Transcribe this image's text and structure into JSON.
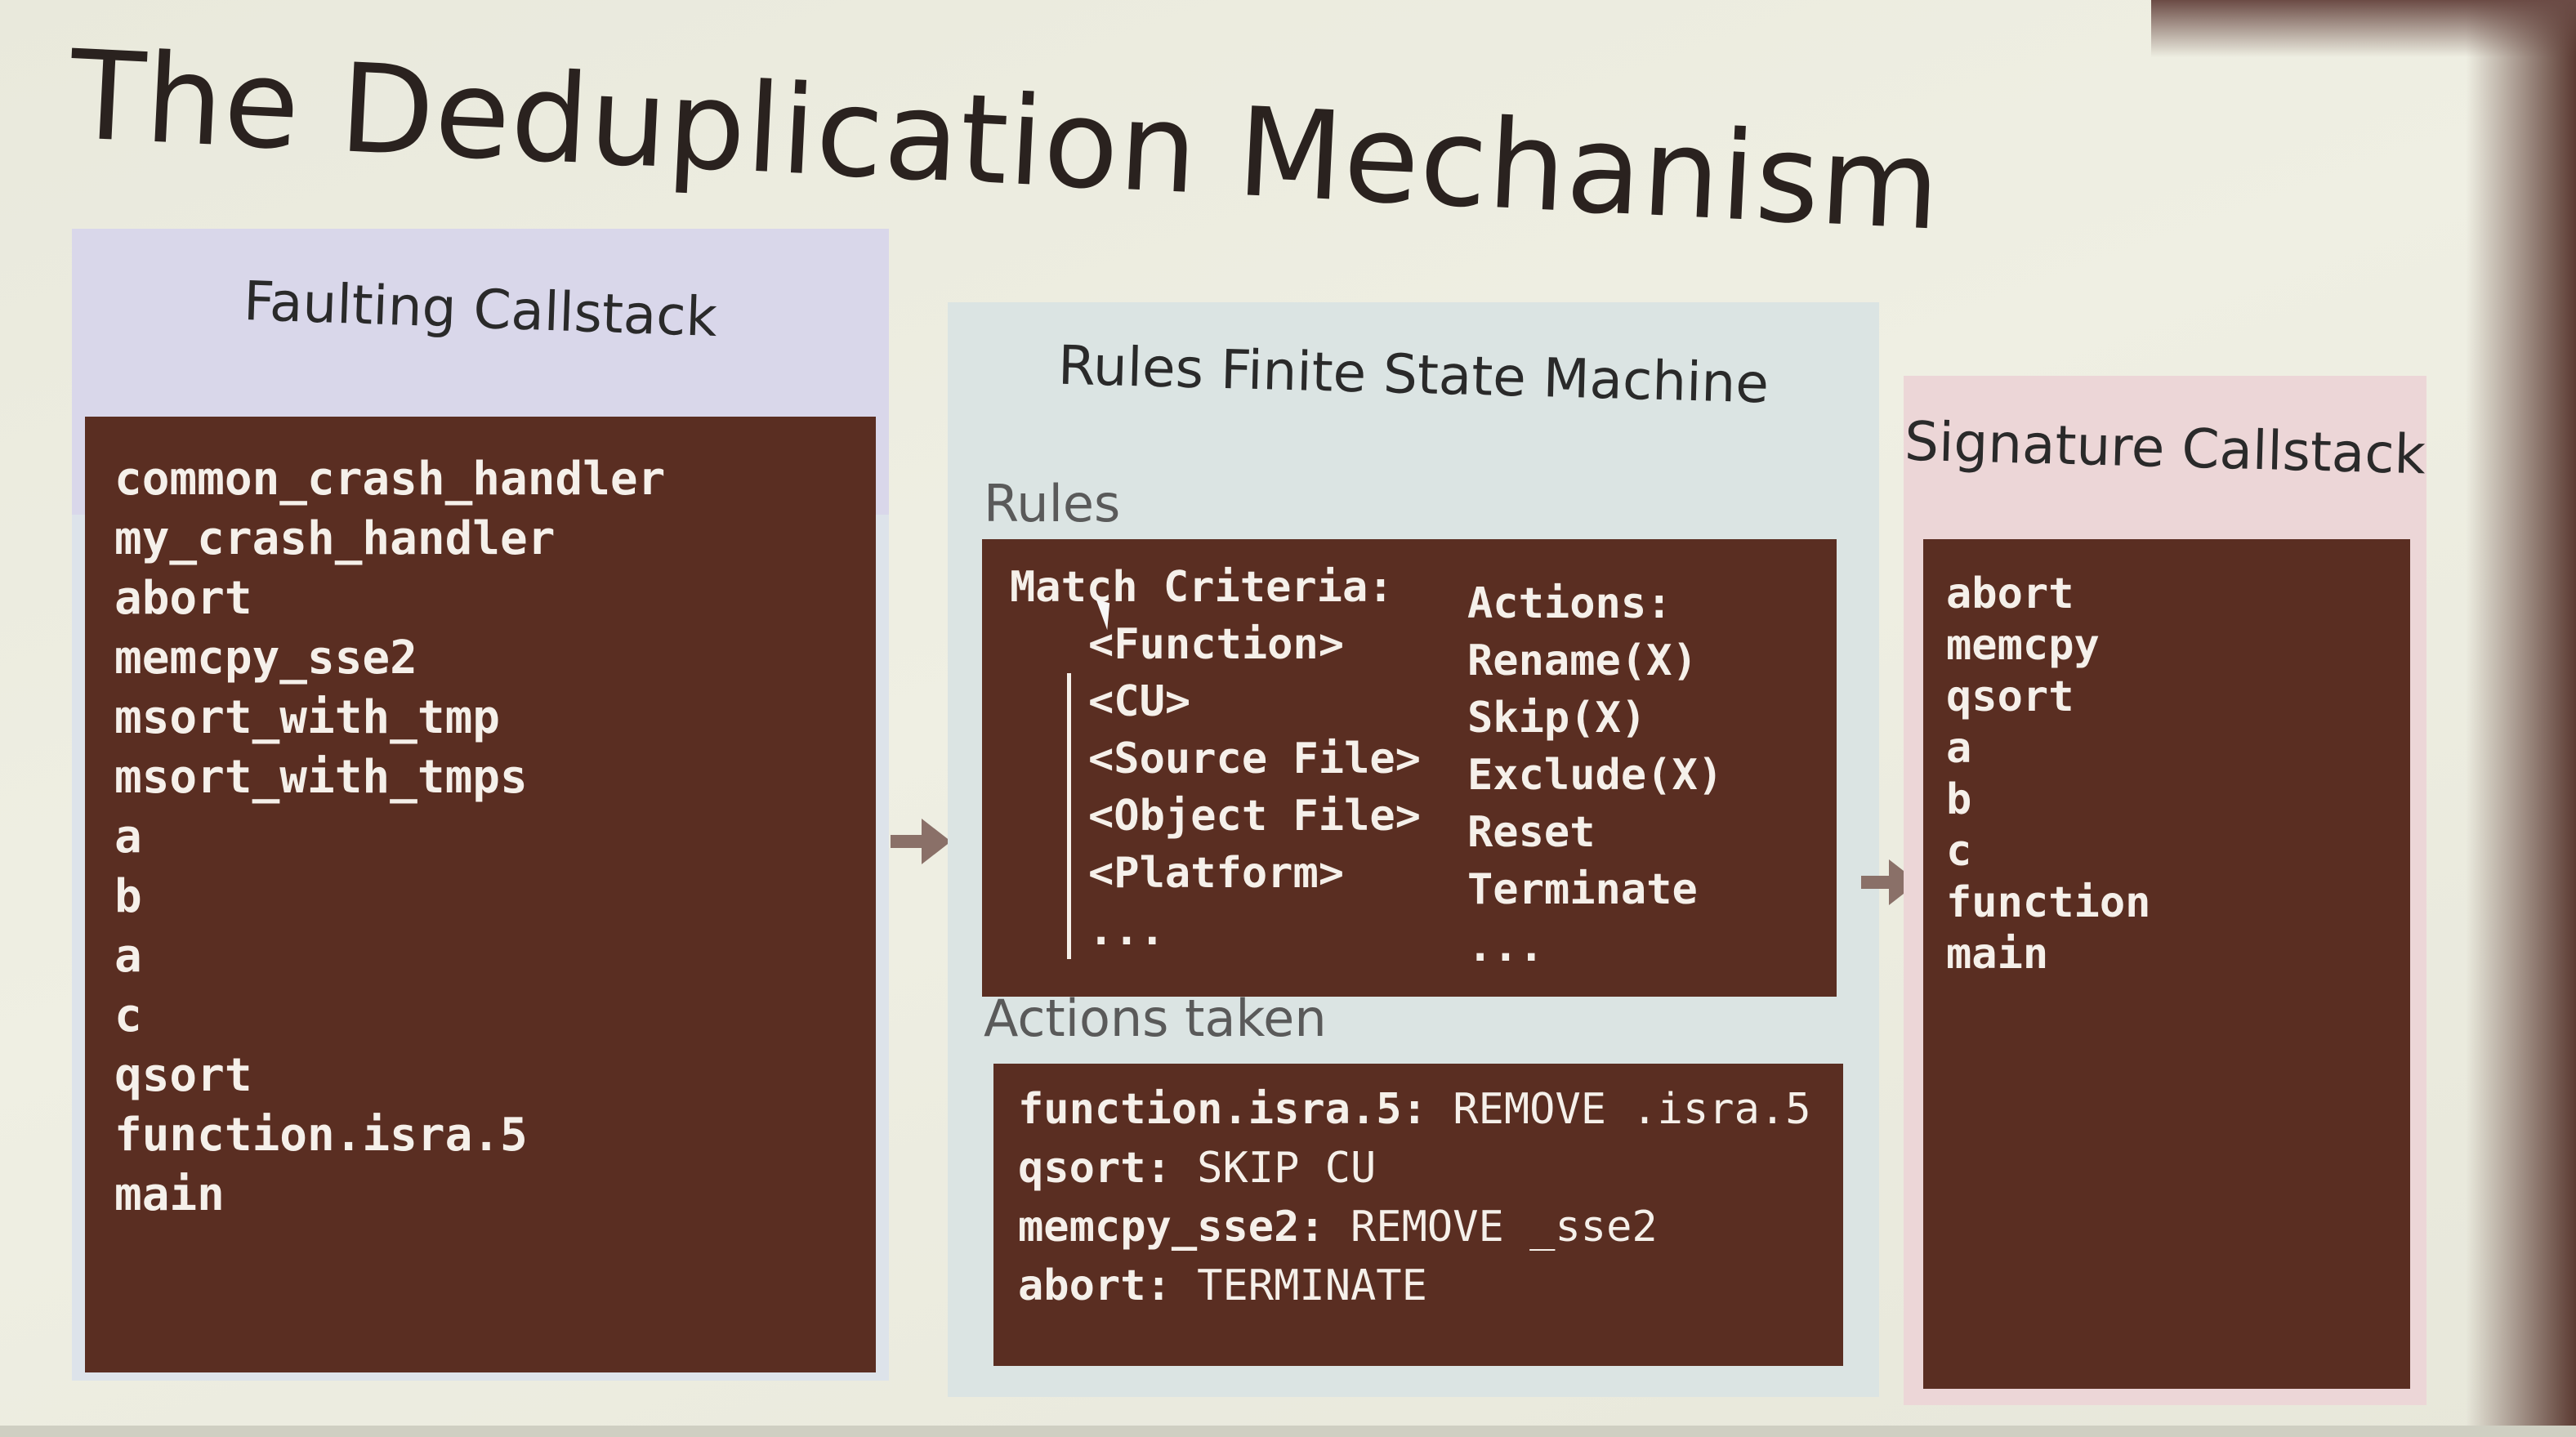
{
  "title": "The Deduplication Mechanism",
  "faulting": {
    "title": "Faulting Callstack",
    "frames": [
      "common_crash_handler",
      "my_crash_handler",
      "abort",
      "memcpy_sse2",
      "msort_with_tmp",
      "msort_with_tmps",
      "a",
      "b",
      "a",
      "c",
      "qsort",
      "function.isra.5",
      "main"
    ]
  },
  "rules_fsm": {
    "title": "Rules Finite State Machine",
    "rules_label": "Rules",
    "match_header": "Match Criteria:",
    "criteria": [
      "<Function>",
      "<CU>",
      "<Source File>",
      "<Object File>",
      "<Platform>",
      "..."
    ],
    "actions_header": "Actions:",
    "actions": [
      "Rename(X)",
      "Skip(X)",
      "Exclude(X)",
      "Reset",
      "Terminate",
      "..."
    ],
    "actions_taken_label": "Actions taken",
    "actions_taken": [
      {
        "frame": "function.isra.5:",
        "action": "REMOVE .isra.5"
      },
      {
        "frame": "qsort:",
        "action": "SKIP CU"
      },
      {
        "frame": "memcpy_sse2:",
        "action": "REMOVE _sse2"
      },
      {
        "frame": "abort:",
        "action": "TERMINATE"
      }
    ]
  },
  "signature": {
    "title": "Signature Callstack",
    "frames": [
      "abort",
      "memcpy",
      "qsort",
      "a",
      "b",
      "c",
      "function",
      "main"
    ]
  },
  "colors": {
    "panel": "#5a2e22",
    "faulting_header": "#d9d7ea",
    "rules_header": "#dbe4e3",
    "signature_header": "#ecd6d7"
  }
}
